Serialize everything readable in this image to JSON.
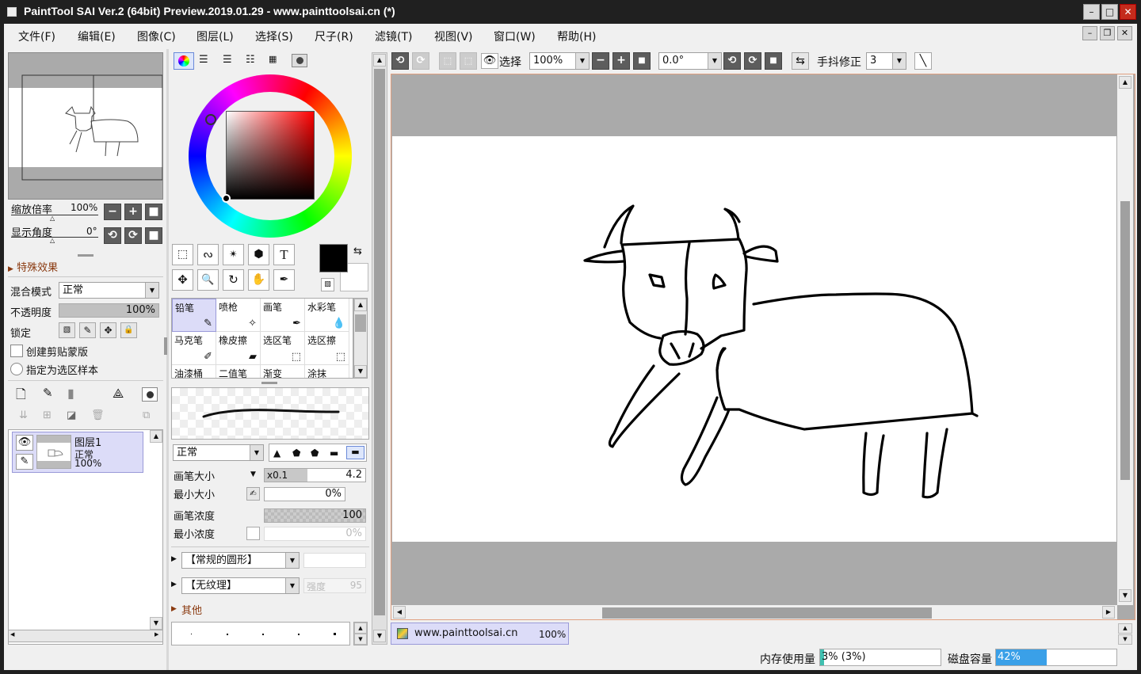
{
  "window": {
    "title": "PaintTool SAI Ver.2 (64bit) Preview.2019.01.29 - www.painttoolsai.cn (*)"
  },
  "menu": [
    "文件(F)",
    "编辑(E)",
    "图像(C)",
    "图层(L)",
    "选择(S)",
    "尺子(R)",
    "滤镜(T)",
    "视图(V)",
    "窗口(W)",
    "帮助(H)"
  ],
  "navigator": {
    "zoom_label": "缩放倍率",
    "zoom_value": "100%",
    "angle_label": "显示角度",
    "angle_value": "0°"
  },
  "layer_panel": {
    "effects_label": "特殊效果",
    "blend_label": "混合模式",
    "blend_value": "正常",
    "opacity_label": "不透明度",
    "opacity_value": "100%",
    "opacity_fraction": 1.0,
    "lock_label": "锁定",
    "clip_label": "创建剪贴蒙版",
    "sample_label": "指定为选区样本",
    "layer": {
      "name": "图层1",
      "mode": "正常",
      "opacity": "100%"
    }
  },
  "tools": {
    "text_tool_glyph": "T",
    "brushes": [
      [
        "铅笔",
        "喷枪",
        "画笔",
        "水彩笔"
      ],
      [
        "马克笔",
        "橡皮擦",
        "选区笔",
        "选区擦"
      ],
      [
        "油漆桶",
        "二值笔",
        "渐变",
        "涂抹"
      ]
    ],
    "selected_brush": "铅笔",
    "blend_mode": "正常",
    "size_label": "画笔大小",
    "size_multiplier": "x0.1",
    "size_value": "4.2",
    "min_size_label": "最小大小",
    "min_size_value": "0%",
    "density_label": "画笔浓度",
    "density_value": "100",
    "min_density_label": "最小浓度",
    "min_density_value": "0%",
    "shape_value": "【常规的圆形】",
    "texture_value": "【无纹理】",
    "texture_strength_label": "强度",
    "texture_strength_value": "95",
    "other_label": "其他",
    "primary_color": "#000000",
    "secondary_color": "#ffffff"
  },
  "toolbar": {
    "select_label": "选择",
    "zoom_value": "100%",
    "angle_value": "0.0°",
    "stabilizer_label": "手抖修正",
    "stabilizer_value": "3"
  },
  "document_tab": {
    "name": "www.painttoolsai.cn",
    "zoom": "100%"
  },
  "status": {
    "memory_label": "内存使用量",
    "memory_value": "3% (3%)",
    "memory_fraction": 0.03,
    "disk_label": "磁盘容量",
    "disk_value": "42%",
    "disk_fraction": 0.42
  },
  "colors": {
    "accent": "#3aa0e8",
    "memory_bar": "#40c0b0",
    "selection": "#dcdcf8",
    "canvas_bg": "#aaaaaa"
  }
}
